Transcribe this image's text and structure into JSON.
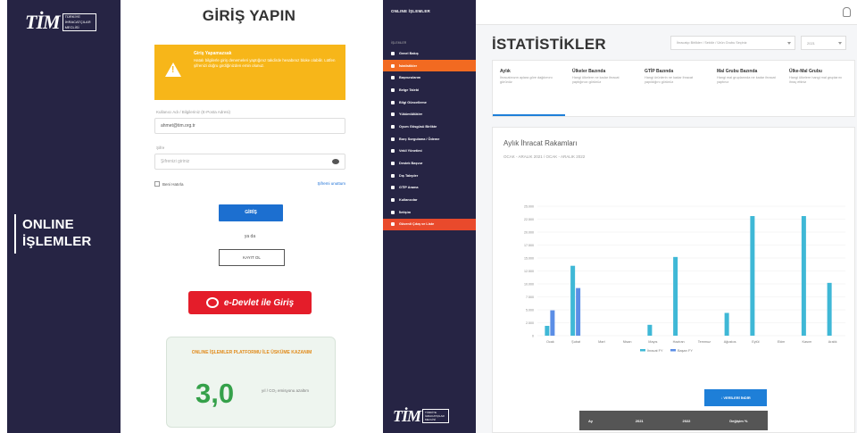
{
  "login": {
    "brand_mark": "TİM",
    "brand_badge": [
      "TÜRKİYE",
      "İHRACATÇILAR",
      "MECLİSİ"
    ],
    "sidebar_title_line1": "ONLINE",
    "sidebar_title_line2": "İŞLEMLER",
    "heading": "GİRİŞ YAPIN",
    "warning_title": "Giriş Yapamazsak",
    "warning_text": "Hatalı bilgilerle giriş denemeleri yaptığınız takdirde hesabınız bloke olabilir. Lütfen şifrenizi doğru girdiğinizden emin olunuz.",
    "email_label": "Kullanıcı Adı / Bilgileriniz (E-Posta Adresi)",
    "email_value": "ahmet@tim.org.tr",
    "password_label": "Şifre",
    "password_value": "Şifrenizi giriniz",
    "remember_label": "Beni Hatırla",
    "forgot_label": "Şifremi unuttum",
    "login_button": "GİRİŞ",
    "or_text": "ya da",
    "register_button": "KAYIT OL",
    "edevlet_button": "e-Devlet ile Giriş",
    "stat_title": "ONLINE İŞLEMLER PLATFORMU İLE ÜSKÜME KAZANIM",
    "stat_value": "3,0",
    "stat_caption": "yıl / CO₂ emisyonu azaltım"
  },
  "dashboard": {
    "brand": "ONLINE İŞLEMLER",
    "nav_caption": "İŞLEMLER",
    "nav_items": [
      {
        "label": "Genel Bakış",
        "state": ""
      },
      {
        "label": "İstatistikler",
        "state": "active"
      },
      {
        "label": "Başvurularım",
        "state": ""
      },
      {
        "label": "Belge Talebi",
        "state": ""
      },
      {
        "label": "Bilgi Güncelleme",
        "state": ""
      },
      {
        "label": "Yükümlülükler",
        "state": ""
      },
      {
        "label": "Oyum Gösgüsü Birlikte",
        "state": ""
      },
      {
        "label": "Borç Sorgulama / Ödeme",
        "state": ""
      },
      {
        "label": "Vekil Yönetimi",
        "state": ""
      },
      {
        "label": "Destek Başvur",
        "state": ""
      },
      {
        "label": "Dış Talepler",
        "state": ""
      },
      {
        "label": "GTİP Arama",
        "state": ""
      },
      {
        "label": "Kullanıcılar",
        "state": ""
      },
      {
        "label": "İletişim",
        "state": ""
      },
      {
        "label": "Güvenli Çıkış ve Liste",
        "state": "red"
      }
    ],
    "logo_mark": "TİM",
    "logo_badge": [
      "TÜRKİYE",
      "İHRACATÇILAR",
      "MECLİSİ"
    ],
    "page_title": "İSTATİSTİKLER",
    "filter_placeholder": "İhracatçı Birlikler / Sektör / Ürün Grubu Seçiniz",
    "year_value": "2021",
    "tabs": [
      {
        "title": "Aylık",
        "desc": "İhracatınızın aylara göre dağılımını görünüz",
        "active": true
      },
      {
        "title": "Ülkeler Bazında",
        "desc": "Hangi ülkelere ne kadar ihracat yaptığınızı görünüz",
        "active": false
      },
      {
        "title": "GTİP Bazında",
        "desc": "Hangi ürünlerin ne kadar ihracat yapıldığını görünüz",
        "active": false
      },
      {
        "title": "Mal Grubu Bazında",
        "desc": "Hangi mal gruplarında ne kadar ihracat yaptınız",
        "active": false
      },
      {
        "title": "Ülke-Mal Grubu",
        "desc": "Hangi ülkelere hangi mal gruplarını ihraç ettiniz",
        "active": false
      }
    ],
    "chart_title": "Aylık İhracat Rakamları",
    "chart_subtitle": "OCAK - ARALIK 2021 / OCAK - ARALIK 2022",
    "csv_button": "↓ VERİLERİ İNDİR",
    "table_headers": [
      "Ay",
      "2021",
      "2022",
      "Değişim %"
    ],
    "colors": {
      "sidebar": "#262444",
      "accent": "#f26a21",
      "bar2021": "#3fb8d6",
      "bar2022": "#5b8ee6"
    }
  },
  "chart_data": {
    "type": "bar",
    "categories": [
      "Ocak",
      "Şubat",
      "Mart",
      "Nisan",
      "Mayıs",
      "Haziran",
      "Temmuz",
      "Ağustos",
      "Eylül",
      "Ekim",
      "Kasım",
      "Aralık"
    ],
    "series": [
      {
        "name": "İhracat FY",
        "values": [
          1.9,
          13.5,
          0,
          0,
          2.1,
          15.2,
          0,
          4.4,
          23.1,
          0,
          23.1,
          10.2
        ]
      },
      {
        "name": "Başarı FY",
        "values": [
          4.9,
          9.2,
          0,
          0,
          0,
          0,
          0,
          0,
          0,
          0,
          0,
          0
        ]
      }
    ],
    "ylim": [
      0,
      25
    ],
    "yticks": [
      "0",
      "2.500",
      "5.000",
      "7.500",
      "10.000",
      "12.500",
      "15.000",
      "17.500",
      "20.000",
      "22.500",
      "25.000"
    ]
  }
}
